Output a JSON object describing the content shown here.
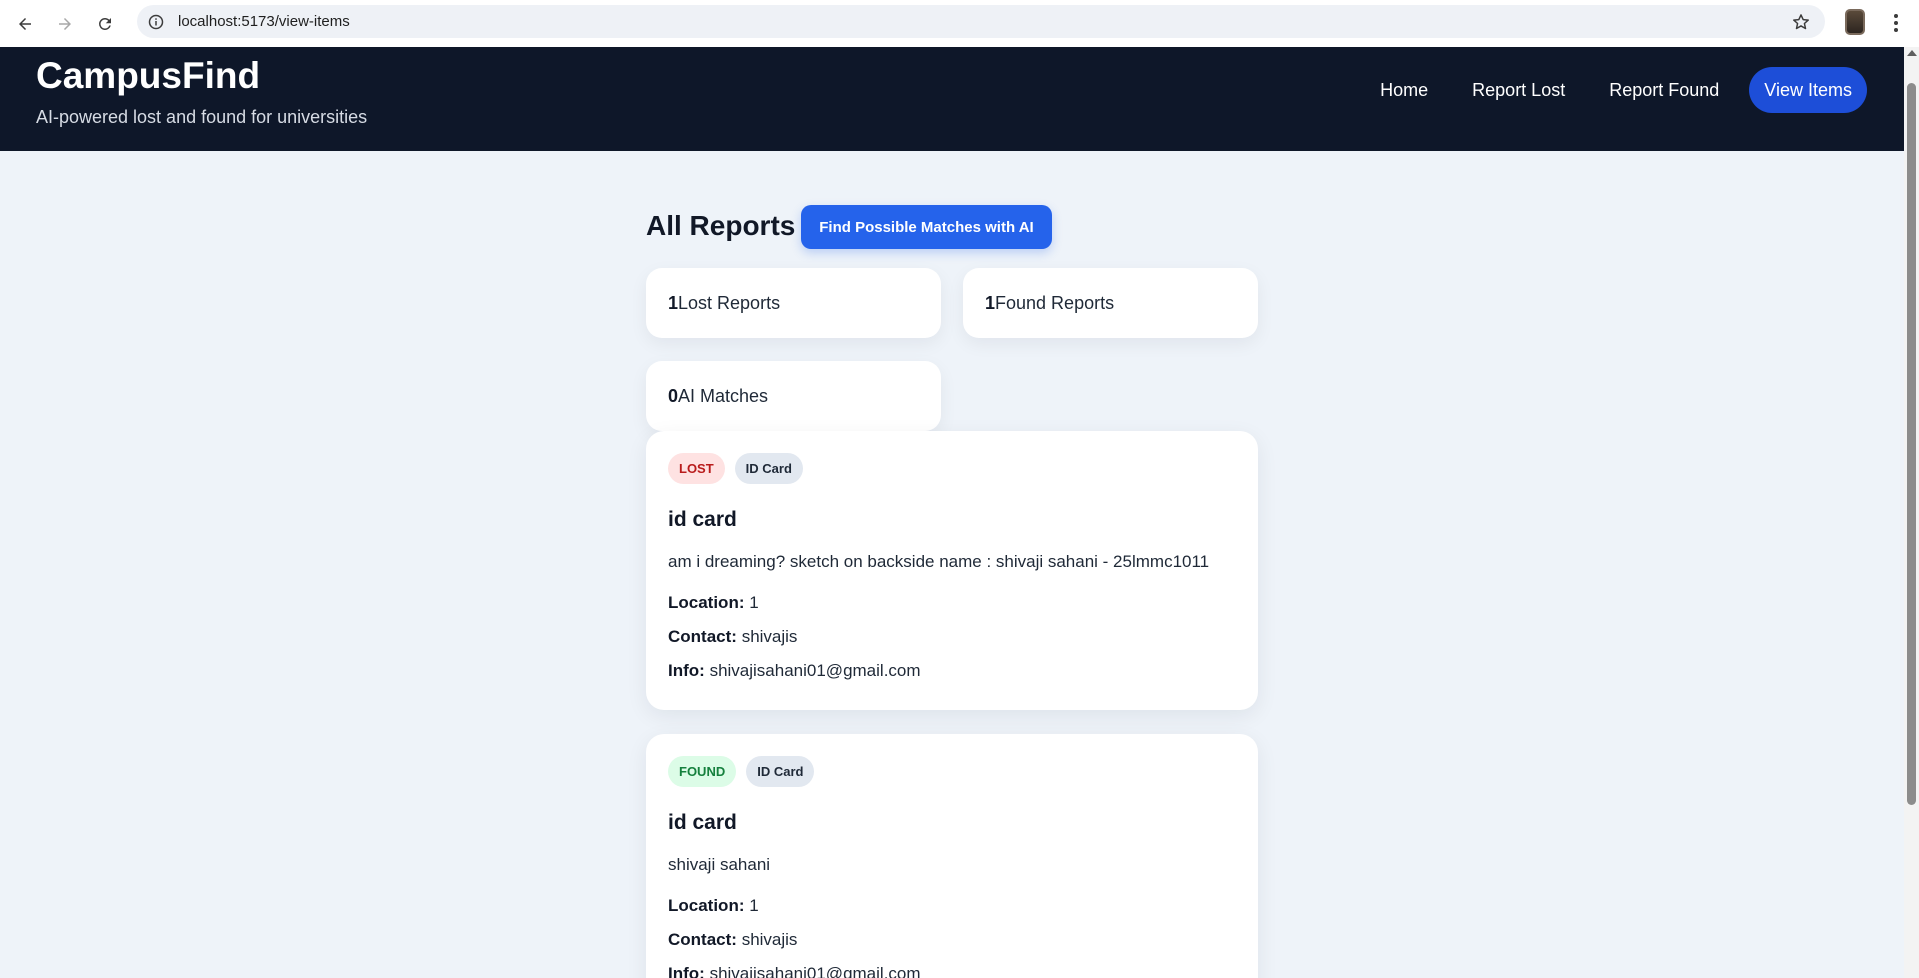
{
  "browser": {
    "url": "localhost:5173/view-items"
  },
  "header": {
    "title": "CampusFind",
    "subtitle": "AI-powered lost and found for universities",
    "nav": [
      {
        "label": "Home"
      },
      {
        "label": "Report Lost"
      },
      {
        "label": "Report Found"
      },
      {
        "label": "View Items",
        "active": true
      }
    ]
  },
  "main": {
    "heading": "All Reports",
    "match_button": "Find Possible Matches with AI",
    "stats": {
      "lost_count": "1",
      "lost_label": "Lost Reports",
      "found_count": "1",
      "found_label": "Found Reports",
      "matches_count": "0",
      "matches_label": "AI Matches"
    },
    "reports": [
      {
        "status": "LOST",
        "category": "ID Card",
        "title": "id card",
        "description": "am i dreaming? sketch on backside name : shivaji sahani - 25lmmc1011",
        "location_label": "Location:",
        "location": "1",
        "contact_label": "Contact:",
        "contact": "shivajis",
        "info_label": "Info:",
        "info": "shivajisahani01@gmail.com"
      },
      {
        "status": "FOUND",
        "category": "ID Card",
        "title": "id card",
        "description": "shivaji sahani",
        "location_label": "Location:",
        "location": "1",
        "contact_label": "Contact:",
        "contact": "shivajis",
        "info_label": "Info:",
        "info": "shivajisahani01@gmail.com"
      }
    ]
  },
  "colors": {
    "header_bg": "#0e1729",
    "accent": "#2563eb",
    "active_nav": "#1d4ed8",
    "page_bg": "#eef3f9",
    "lost_badge_bg": "#fee2e2",
    "lost_badge_text": "#b91c1c",
    "found_badge_bg": "#dcfce7",
    "found_badge_text": "#15803d"
  }
}
